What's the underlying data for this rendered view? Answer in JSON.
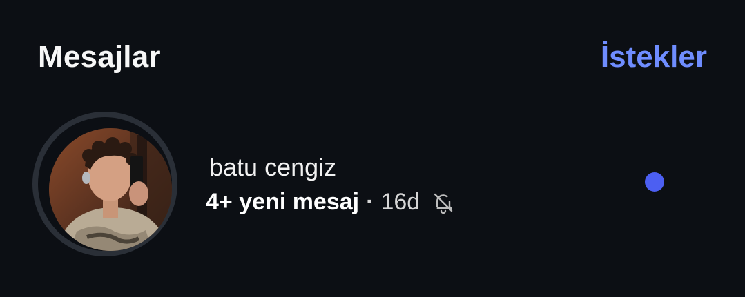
{
  "header": {
    "title": "Mesajlar",
    "requests_label": "İstekler"
  },
  "thread": {
    "name": "batu cengiz",
    "unread_text": "4+ yeni mesaj",
    "separator": "·",
    "time": "16d",
    "status_icon": "bell-muted-icon"
  },
  "colors": {
    "background": "#0c0f14",
    "accent_link": "#6f8dff",
    "unread_dot": "#4c5ff2"
  }
}
